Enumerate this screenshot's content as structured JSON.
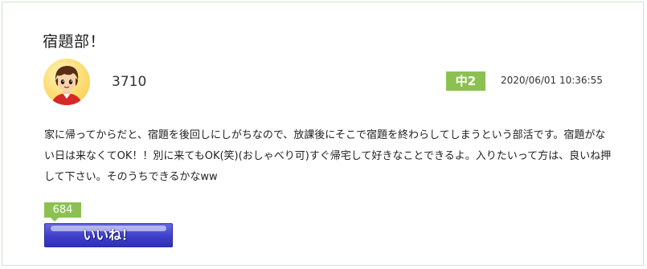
{
  "post": {
    "title": "宿題部！",
    "author": "3710",
    "grade_badge": "中2",
    "datetime": "2020/06/01 10:36:55",
    "body": "家に帰ってからだと、宿題を後回しにしがちなので、放課後にそこで宿題を終わらしてしまうという部活です。宿題がない日は来なくてOK！！別に来てもOK(笑)(おしゃべり可)すぐ帰宅して好きなことできるよ。入りたいって方は、良いね押して下さい。そのうちできるかなww",
    "like_count": "684",
    "like_label": "いいね！",
    "avatar_icon": "boy-avatar-icon",
    "accent_color": "#8cc152",
    "like_button_color": "#3f3fc9"
  }
}
